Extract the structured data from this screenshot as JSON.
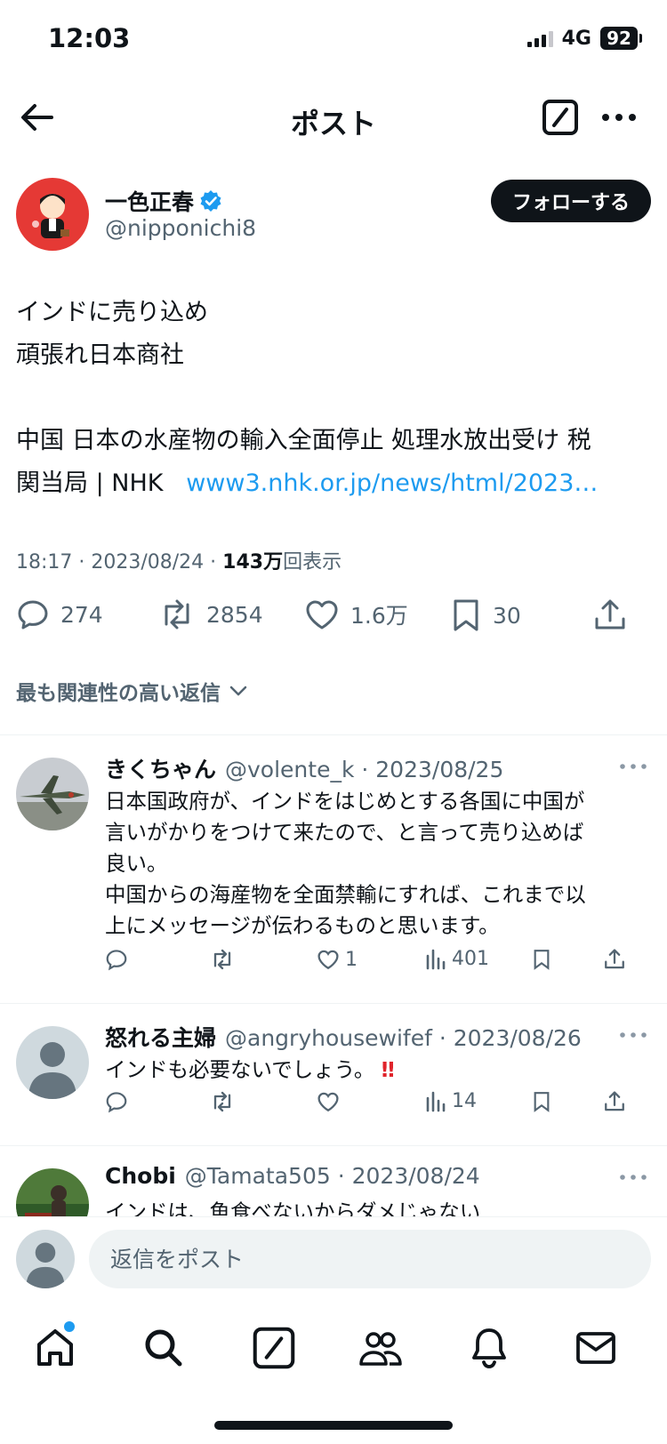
{
  "status": {
    "time": "12:03",
    "network": "4G",
    "battery": "92"
  },
  "header": {
    "title": "ポスト"
  },
  "author": {
    "name": "一色正春",
    "handle": "@nipponichi8",
    "follow_label": "フォローする"
  },
  "post": {
    "line1": "インドに売り込め",
    "line2": "頑張れ日本商社",
    "line3": "中国 日本の水産物の輸入全面停止 処理水放出受け 税",
    "line4_text": "関当局 | NHK",
    "line4_link": "www3.nhk.or.jp/news/html/2023…",
    "time": "18:17 · 2023/08/24 · ",
    "views": "143万",
    "views_label": "回表示"
  },
  "stats": {
    "replies": "274",
    "reposts": "2854",
    "likes": "1.6万",
    "bookmarks": "30"
  },
  "relevance_label": "最も関連性の高い返信",
  "replies": [
    {
      "name": "きくちゃん",
      "meta": "@volente_k · 2023/08/25",
      "lines": [
        "日本国政府が、インドをはじめとする各国に中国が",
        "言いがかりをつけて来たので、と言って売り込めば",
        "良い。",
        "中国からの海産物を全面禁輸にすれば、これまで以",
        "上にメッセージが伝わるものと思います。"
      ],
      "likes": "1",
      "views": "401"
    },
    {
      "name": "怒れる主婦",
      "meta": "@angryhousewifef · 2023/08/26",
      "line": "インドも必要ないでしょう。",
      "emoji": "‼",
      "likes": "",
      "views": "14"
    },
    {
      "name": "Chobi",
      "meta": "@Tamata505 · 2023/08/24",
      "line": "インドは、魚食べないからダメじゃない"
    }
  ],
  "reply_bar": {
    "placeholder": "返信をポスト"
  },
  "colors": {
    "accent": "#1d9bf0",
    "text": "#0f1419",
    "muted": "#536471",
    "verified": "#1d9bf0",
    "avatar_red": "#e53935"
  }
}
